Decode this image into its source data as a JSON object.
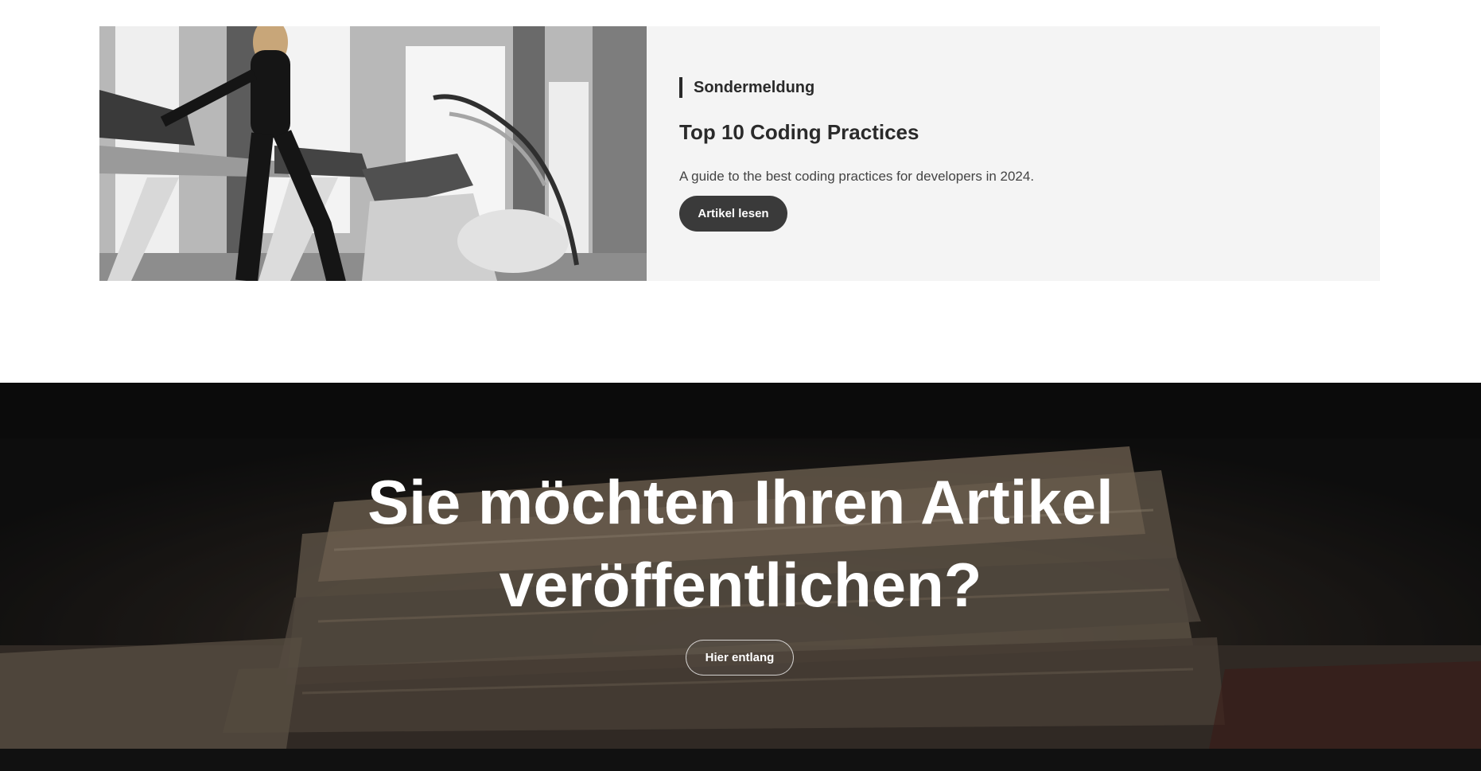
{
  "feature": {
    "eyebrow": "Sondermeldung",
    "title": "Top 10 Coding Practices",
    "excerpt": "A guide to the best coding practices for developers in 2024.",
    "button_label": "Artikel lesen",
    "image_alt": "Person on treadmill in a gym"
  },
  "cta": {
    "headline_line1": "Sie möchten Ihren Artikel",
    "headline_line2": "veröffentlichen?",
    "button_label": "Hier entlang"
  },
  "colors": {
    "card_background": "#f4f4f4",
    "dark_button": "#3a3a3a",
    "text_dark": "#2a2a2a",
    "footer": "#111111"
  }
}
